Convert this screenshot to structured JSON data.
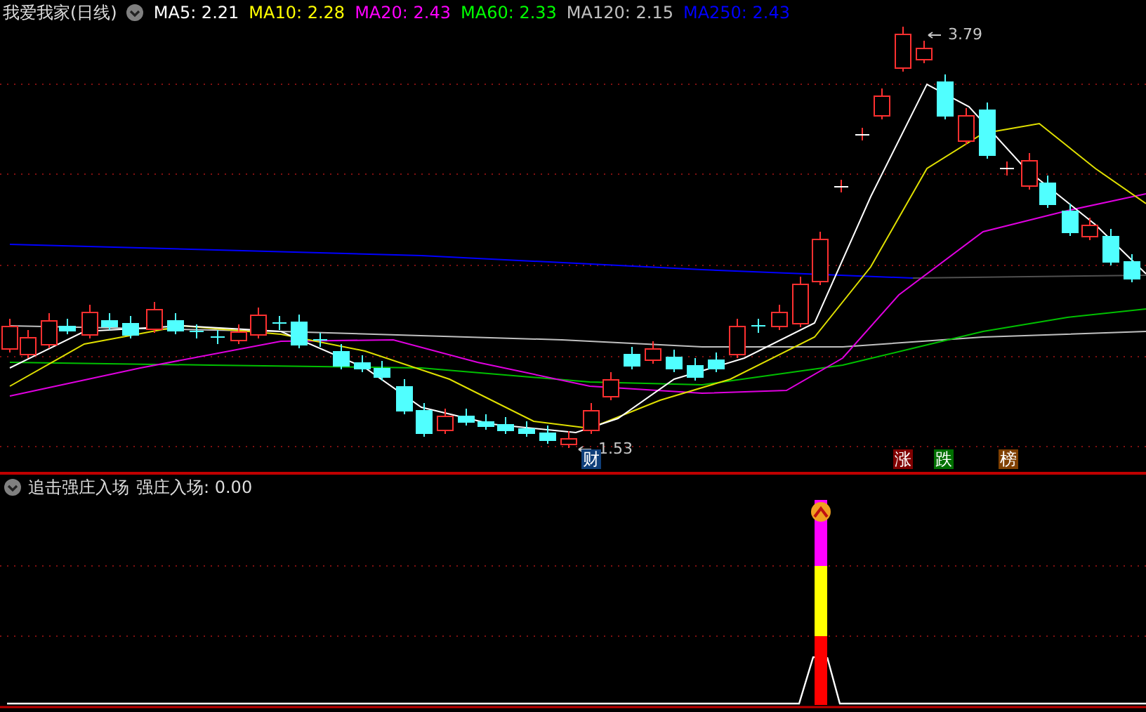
{
  "title": "我爱我家(日线)",
  "indicators": [
    {
      "label": "MA5: 2.21",
      "color": "#ffffff"
    },
    {
      "label": "MA10: 2.28",
      "color": "#ffff00"
    },
    {
      "label": "MA20: 2.43",
      "color": "#ff00ff"
    },
    {
      "label": "MA60: 2.33",
      "color": "#00ff00"
    },
    {
      "label": "MA120: 2.15",
      "color": "#c0c0c0"
    },
    {
      "label": "MA250: 2.43",
      "color": "#0000ff"
    }
  ],
  "price_marks": [
    {
      "kind": "high",
      "text": "3.79"
    },
    {
      "kind": "low",
      "text": "1.53"
    }
  ],
  "event_tags": [
    {
      "text": "财",
      "color": "#0f3f7a"
    },
    {
      "text": "涨",
      "color": "#800000"
    },
    {
      "text": "跌",
      "color": "#007000"
    },
    {
      "text": "榜",
      "color": "#804000"
    }
  ],
  "sub_panel": {
    "title": "追击强庄入场",
    "reading": "强庄入场: 0.00"
  }
}
